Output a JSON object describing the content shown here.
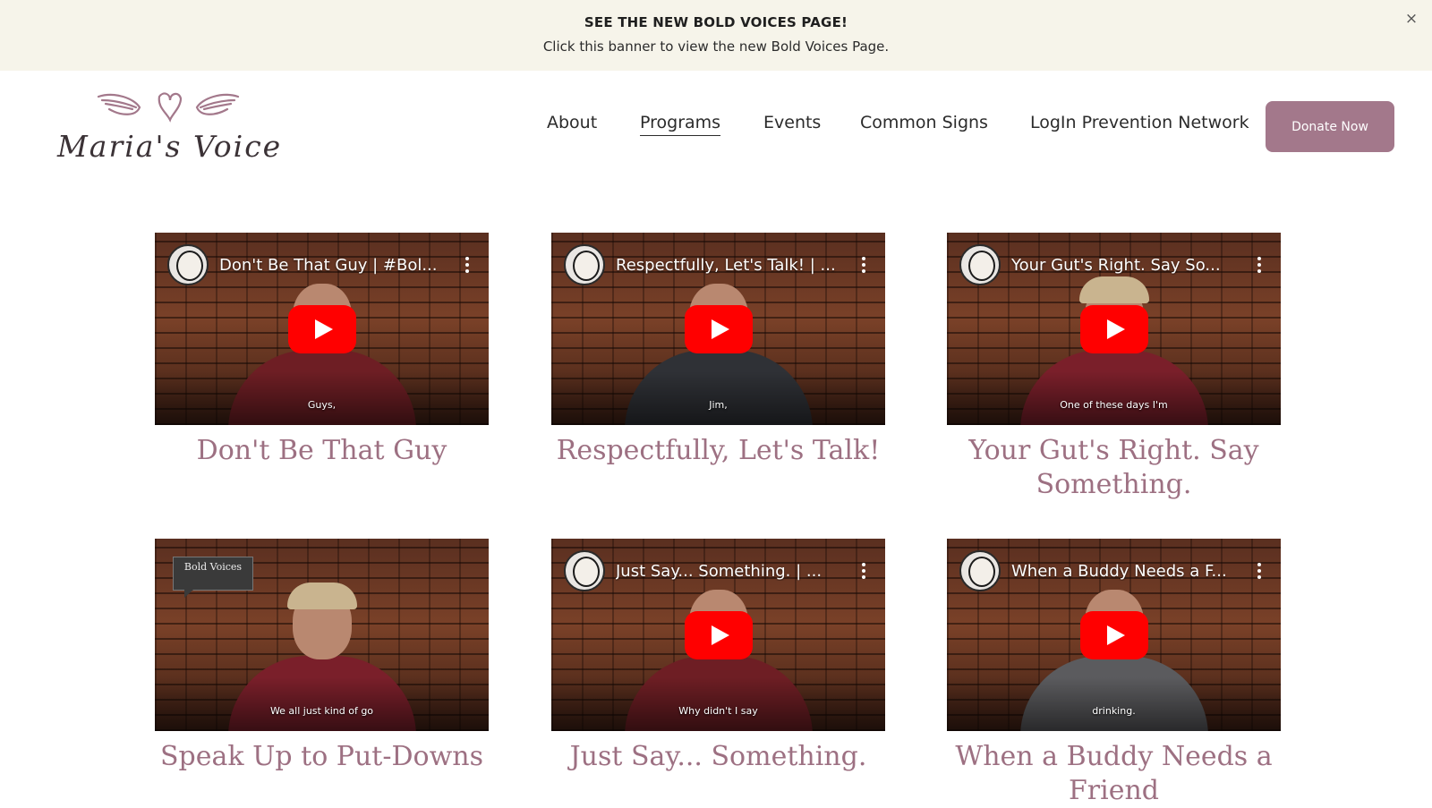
{
  "banner": {
    "title": "SEE THE NEW BOLD VOICES PAGE!",
    "text": "Click this banner to view the new Bold Voices Page.",
    "close_icon": "×"
  },
  "logo": {
    "text": "Maria's Voice"
  },
  "nav": {
    "items": [
      {
        "label": "About"
      },
      {
        "label": "Programs",
        "active": true
      },
      {
        "label": "Events"
      },
      {
        "label": "Common Signs"
      },
      {
        "label": "LogIn Prevention Network"
      }
    ],
    "donate_label": "Donate Now"
  },
  "colors": {
    "accent": "#a3788b",
    "title_color": "#9d7082",
    "banner_bg": "#f6f4ea",
    "youtube_red": "#ff0000"
  },
  "videos": [
    {
      "video_title": "Don't Be That Guy | #Bol...",
      "caption": "Guys,",
      "title": "Don't Be That Guy",
      "shirt": "#6e1e24"
    },
    {
      "video_title": "Respectfully, Let's Talk! | ...",
      "caption": "Jim,",
      "title": "Respectfully, Let's Talk!",
      "shirt": "#2f3136"
    },
    {
      "video_title": "Your Gut's Right. Say So...",
      "caption": "One of these days I'm",
      "title": "Your Gut's Right. Say Something.",
      "shirt": "#7a1f2a"
    },
    {
      "video_title": "",
      "caption": "We all just kind of go",
      "title": "Speak Up to Put-Downs",
      "shirt": "#7a1f2a",
      "badge": "Bold Voices"
    },
    {
      "video_title": "Just Say... Something. | ...",
      "caption": "Why didn't I say",
      "title": "Just Say... Something.",
      "shirt": "#6e1e24"
    },
    {
      "video_title": "When a Buddy Needs a F...",
      "caption": "drinking.",
      "title": "When a Buddy Needs a Friend",
      "shirt": "#5b5b5e"
    }
  ]
}
